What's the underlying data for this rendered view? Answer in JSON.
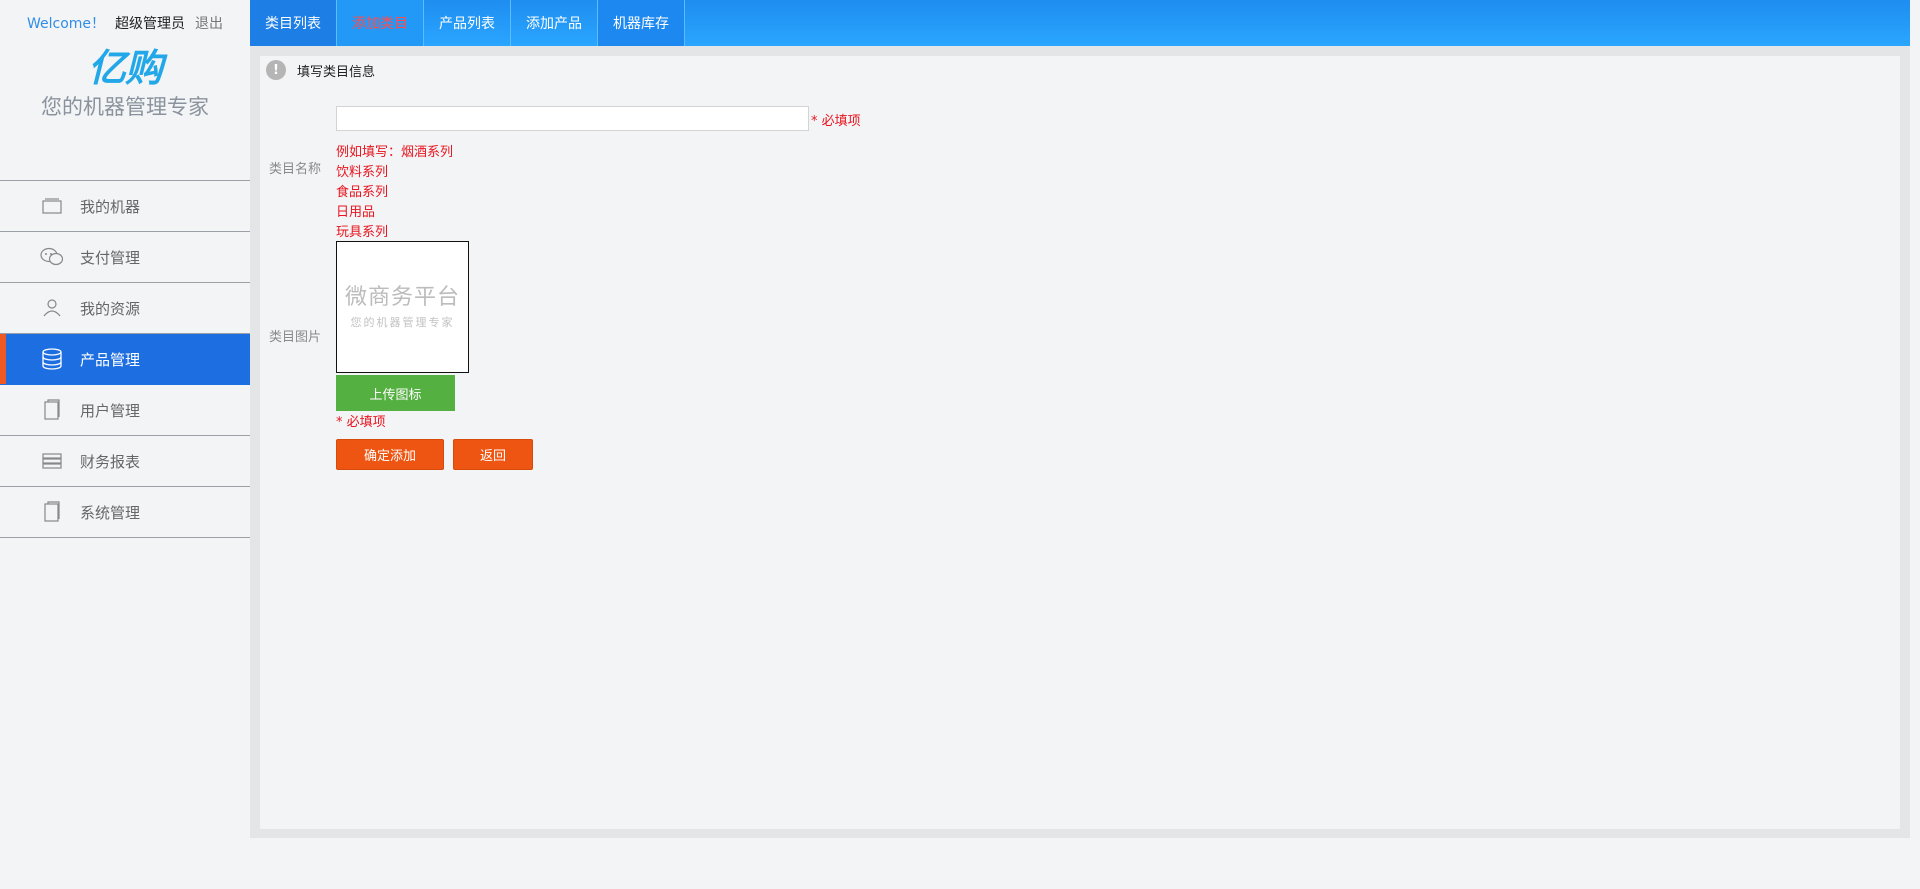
{
  "header": {
    "welcome": "Welcome！",
    "user": "超级管理员",
    "logout": "退出"
  },
  "brand": {
    "logo": "亿购",
    "tagline": "您的机器管理专家"
  },
  "sidebar": {
    "items": [
      {
        "label": "我的机器",
        "icon": "machine-icon"
      },
      {
        "label": "支付管理",
        "icon": "wechat-icon"
      },
      {
        "label": "我的资源",
        "icon": "user-icon"
      },
      {
        "label": "产品管理",
        "icon": "database-icon",
        "active": true
      },
      {
        "label": "用户管理",
        "icon": "document-icon"
      },
      {
        "label": "财务报表",
        "icon": "list-icon"
      },
      {
        "label": "系统管理",
        "icon": "document-icon"
      }
    ]
  },
  "tabs": [
    {
      "label": "类目列表"
    },
    {
      "label": "添加类目",
      "current": true
    },
    {
      "label": "产品列表"
    },
    {
      "label": "添加产品"
    },
    {
      "label": "机器库存"
    }
  ],
  "form": {
    "section_title": "填写类目信息",
    "name_label": "类目名称",
    "name_value": "",
    "required_text": "* 必填项",
    "hint_lines": [
      "例如填写：烟酒系列",
      "饮料系列",
      "食品系列",
      "日用品",
      "玩具系列"
    ],
    "image_label": "类目图片",
    "watermark_title": "微商务平台",
    "watermark_sub": "您的机器管理专家",
    "upload_label": "上传图标",
    "image_required_text": "* 必填项",
    "confirm_label": "确定添加",
    "back_label": "返回"
  },
  "colors": {
    "topbar": "#1e8df0",
    "active_nav": "#1d6ee0",
    "accent": "#f05a22",
    "required": "#e8141e",
    "upload": "#55b042"
  }
}
